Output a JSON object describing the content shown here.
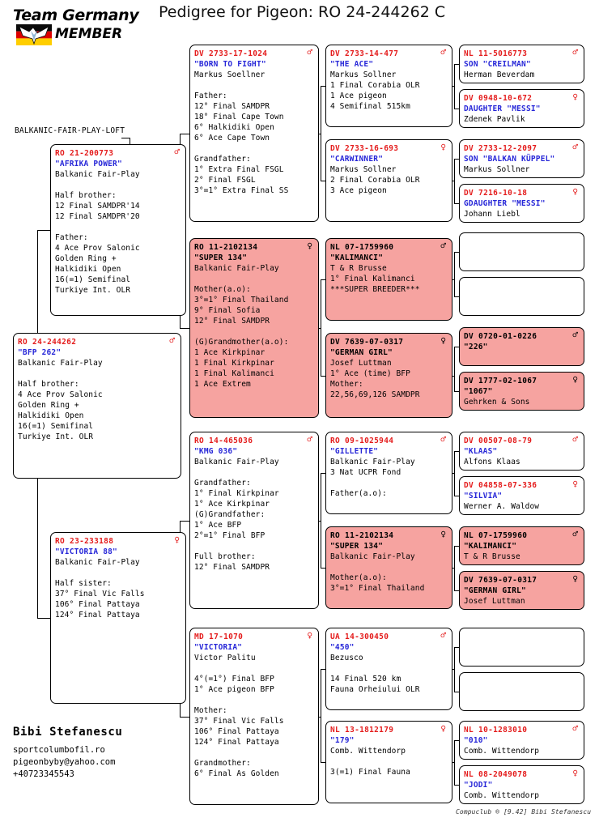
{
  "header": {
    "title": "Pedigree for Pigeon: RO  24-244262 C",
    "logo_line1": "Team Germany",
    "logo_line2": "MEMBER",
    "logo_icon": "german-flag-eagle-logo"
  },
  "loft": {
    "name": "BALKANIC-FAIR-PLAY-LOFT"
  },
  "owner": {
    "name": "Bibi Stefanescu",
    "website": "sportcolumbofil.ro",
    "email": "pigeonbyby@yahoo.com",
    "phone": "+40723345543"
  },
  "footer": {
    "credit": "Compuclub ® [9.42]  Bibi Stefanescu"
  },
  "symbols": {
    "male": "♂",
    "female": "♀"
  },
  "colors": {
    "ring": "#e41c1c",
    "name": "#2727d8",
    "pink_box": "#f6a3a0",
    "white_box": "#ffffff",
    "border": "#000000"
  },
  "subject": {
    "country": "RO",
    "ring": "24-244262",
    "sex": "male",
    "name": "\"BFP 262\"",
    "owner": "Balkanic Fair-Play",
    "body": "\nHalf brother:\n4 Ace Prov Salonic\nGolden Ring +\nHalkidiki Open\n16(=1) Semifinal\nTurkiye Int. OLR"
  },
  "gen1": [
    {
      "country": "RO",
      "ring": "21-200773",
      "sex": "male",
      "name": "\"AFRIKA POWER\"",
      "owner": "Balkanic Fair-Play",
      "body": "\nHalf brother:\n12 Final SAMDPR'14\n12 Final SAMDPR'20\n\nFather:\n4 Ace Prov Salonic\nGolden Ring +\nHalkidiki Open\n16(=1) Semifinal\nTurkiye Int. OLR",
      "pink": false
    },
    {
      "country": "RO",
      "ring": "23-233188",
      "sex": "female",
      "name": "\"VICTORIA 88\"",
      "owner": "Balkanic Fair-Play",
      "body": "\nHalf sister:\n37° Final Vic Falls\n106° Final Pattaya\n124° Final Pattaya",
      "pink": false
    }
  ],
  "gen2": [
    {
      "country": "DV",
      "ring": "2733-17-1024",
      "sex": "male",
      "name": "\"BORN TO FIGHT\"",
      "owner": "Markus Soellner",
      "body": "\nFather:\n12° Final SAMDPR\n18° Final Cape Town\n6° Halkidiki Open\n6° Ace Cape Town\n\nGrandfather:\n1° Extra Final FSGL\n2° Final FSGL\n3°=1° Extra Final SS",
      "pink": false
    },
    {
      "country": "RO",
      "ring": "11-2102134",
      "sex": "female",
      "name": "\"SUPER 134\"",
      "owner": "Balkanic Fair-Play",
      "body": "\nMother(a.o):\n3°=1° Final Thailand\n9° Final Sofia\n12° Final SAMDPR\n\n(G)Grandmother(a.o):\n1 Ace Kirkpinar\n1 Final Kirkpinar\n1 Final Kalimanci\n1 Ace Extrem",
      "pink": true
    },
    {
      "country": "RO",
      "ring": "14-465036",
      "sex": "male",
      "name": "\"KMG 036\"",
      "owner": "Balkanic Fair-Play",
      "body": "\nGrandfather:\n1° Final Kirkpinar\n1° Ace Kirkpinar\n(G)Grandfather:\n1° Ace BFP\n2°=1° Final BFP\n\nFull brother:\n12° Final SAMDPR",
      "pink": false
    },
    {
      "country": "MD",
      "ring": "17-1070",
      "sex": "female",
      "name": "\"VICTORIA\"",
      "owner": "Victor Palitu",
      "body": "\n4°(=1°) Final BFP\n1° Ace pigeon BFP\n\nMother:\n37° Final Vic Falls\n106° Final Pattaya\n124° Final Pattaya\n\nGrandmother:\n6° Final As Golden",
      "pink": false
    }
  ],
  "gen3": [
    {
      "country": "DV",
      "ring": "2733-14-477",
      "sex": "male",
      "name": "\"THE ACE\"",
      "owner": "Markus Sollner",
      "body": "1 Final Corabia OLR\n1 Ace pigeon\n4 Semifinal 515km",
      "pink": false
    },
    {
      "country": "DV",
      "ring": "2733-16-693",
      "sex": "female",
      "name": "\"CARWINNER\"",
      "owner": "Markus Sollner",
      "body": "2 Final Corabia OLR\n3 Ace pigeon",
      "pink": false
    },
    {
      "country": "NL",
      "ring": "07-1759960",
      "sex": "male",
      "name": "\"KALIMANCI\"",
      "owner": "T & R Brusse",
      "body": "1° Final Kalimanci\n***SUPER BREEDER***",
      "pink": true
    },
    {
      "country": "DV",
      "ring": "7639-07-0317",
      "sex": "female",
      "name": "\"GERMAN GIRL\"",
      "owner": "Josef Luttman",
      "body": "1° Ace (time) BFP\nMother:\n22,56,69,126 SAMDPR",
      "pink": true
    },
    {
      "country": "RO",
      "ring": "09-1025944",
      "sex": "male",
      "name": "\"GILLETTE\"",
      "owner": "Balkanic Fair-Play",
      "body": "3 Nat UCPR Fond\n\nFather(a.o):",
      "pink": false
    },
    {
      "country": "RO",
      "ring": "11-2102134",
      "sex": "female",
      "name": "\"SUPER 134\"",
      "owner": "Balkanic Fair-Play",
      "body": "\nMother(a.o):\n3°=1° Final Thailand",
      "pink": true
    },
    {
      "country": "UA",
      "ring": "14-300450",
      "sex": "male",
      "name": "\"450\"",
      "owner": "Bezusco",
      "body": "\n14 Final 520 km\nFauna Orheiului OLR",
      "pink": false
    },
    {
      "country": "NL",
      "ring": "13-1812179",
      "sex": "female",
      "name": "\"179\"",
      "owner": "Comb. Wittendorp",
      "body": "\n3(=1) Final Fauna",
      "pink": false
    }
  ],
  "gen4": [
    {
      "country": "NL",
      "ring": "11-5016773",
      "sex": "male",
      "name": "SON \"CREILMAN\"",
      "owner": "Herman Beverdam",
      "body": "",
      "pink": false,
      "empty": false
    },
    {
      "country": "DV",
      "ring": "0948-10-672",
      "sex": "female",
      "name": "DAUGHTER \"MESSI\"",
      "owner": "Zdenek Pavlik",
      "body": "",
      "pink": false,
      "empty": false
    },
    {
      "country": "DV",
      "ring": "2733-12-2097",
      "sex": "male",
      "name": "SON \"BALKAN KÜPPEL\"",
      "owner": "Markus Sollner",
      "body": "",
      "pink": false,
      "empty": false
    },
    {
      "country": "DV",
      "ring": "7216-10-18",
      "sex": "female",
      "name": "GDAUGHTER \"MESSI\"",
      "owner": "Johann Liebl",
      "body": "",
      "pink": false,
      "empty": false
    },
    {
      "country": "",
      "ring": "",
      "sex": "",
      "name": "",
      "owner": "",
      "body": "",
      "pink": false,
      "empty": true
    },
    {
      "country": "",
      "ring": "",
      "sex": "",
      "name": "",
      "owner": "",
      "body": "",
      "pink": false,
      "empty": true
    },
    {
      "country": "DV",
      "ring": "0720-01-0226",
      "sex": "male",
      "name": "\"226\"",
      "owner": "",
      "body": "",
      "pink": true,
      "empty": false
    },
    {
      "country": "DV",
      "ring": "1777-02-1067",
      "sex": "female",
      "name": "\"1067\"",
      "owner": "Gehrken & Sons",
      "body": "",
      "pink": true,
      "empty": false
    },
    {
      "country": "DV",
      "ring": "00507-08-79",
      "sex": "male",
      "name": "\"KLAAS\"",
      "owner": "Alfons Klaas",
      "body": "",
      "pink": false,
      "empty": false
    },
    {
      "country": "DV",
      "ring": "04858-07-336",
      "sex": "female",
      "name": "\"SILVIA\"",
      "owner": "Werner A. Waldow",
      "body": "",
      "pink": false,
      "empty": false
    },
    {
      "country": "NL",
      "ring": "07-1759960",
      "sex": "male",
      "name": "\"KALIMANCI\"",
      "owner": "T & R Brusse",
      "body": "",
      "pink": true,
      "empty": false
    },
    {
      "country": "DV",
      "ring": "7639-07-0317",
      "sex": "female",
      "name": "\"GERMAN GIRL\"",
      "owner": "Josef Luttman",
      "body": "",
      "pink": true,
      "empty": false
    },
    {
      "country": "",
      "ring": "",
      "sex": "",
      "name": "",
      "owner": "",
      "body": "",
      "pink": false,
      "empty": true
    },
    {
      "country": "",
      "ring": "",
      "sex": "",
      "name": "",
      "owner": "",
      "body": "",
      "pink": false,
      "empty": true
    },
    {
      "country": "NL",
      "ring": "10-1283010",
      "sex": "male",
      "name": "\"010\"",
      "owner": "Comb. Wittendorp",
      "body": "",
      "pink": false,
      "empty": false
    },
    {
      "country": "NL",
      "ring": "08-2049078",
      "sex": "female",
      "name": "\"JODI\"",
      "owner": "Comb. Wittendorp",
      "body": "",
      "pink": false,
      "empty": false
    }
  ]
}
